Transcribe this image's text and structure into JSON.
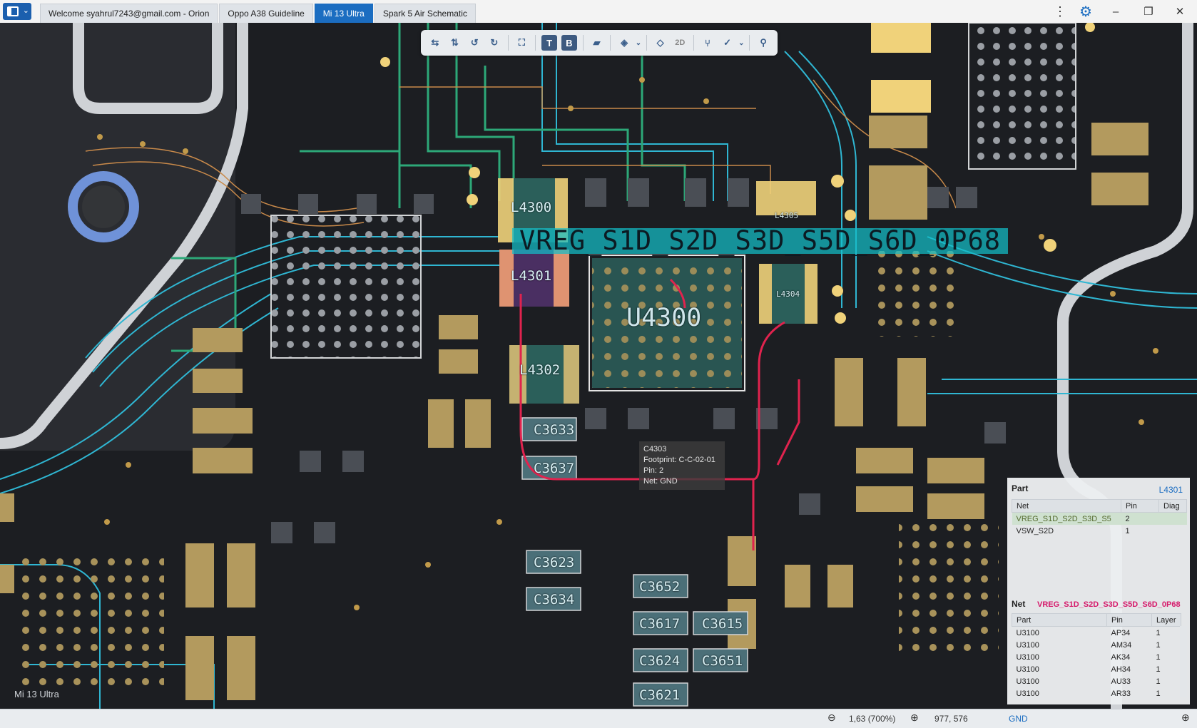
{
  "tabs": [
    {
      "label": "Welcome syahrul7243@gmail.com - Orion",
      "active": false
    },
    {
      "label": "Oppo A38 Guideline",
      "active": false
    },
    {
      "label": "Mi 13 Ultra",
      "active": true
    },
    {
      "label": "Spark 5 Air Schematic",
      "active": false
    }
  ],
  "toolbar": {
    "top_label": "T",
    "bottom_label": "B",
    "view_2d_label": "2D"
  },
  "board": {
    "name": "Mi 13 Ultra",
    "highlighted_net": "VREG_S1D_S2D_S3D_S5D_S6D_0P68",
    "part_labels": [
      "L4300",
      "L4301",
      "L4302",
      "L4305",
      "L4304",
      "U4300",
      "C3633",
      "C3637",
      "C3623",
      "C3634",
      "C3652",
      "C3617",
      "C3615",
      "C3624",
      "C3651",
      "C3621"
    ]
  },
  "tooltip": {
    "part": "C4303",
    "footprint": "Footprint: C-C-02-01",
    "pin": "Pin: 2",
    "net": "Net: GND"
  },
  "part_panel": {
    "title": "Part",
    "part_ref": "L4301",
    "columns": [
      "Net",
      "Pin",
      "Diag"
    ],
    "rows": [
      {
        "net": "VREG_S1D_S2D_S3D_S5",
        "pin": "2",
        "diag": ""
      },
      {
        "net": "VSW_S2D",
        "pin": "1",
        "diag": ""
      }
    ]
  },
  "net_panel": {
    "title": "Net",
    "net_name": "VREG_S1D_S2D_S3D_S5D_S6D_0P68",
    "columns": [
      "Part",
      "Pin",
      "Layer"
    ],
    "rows": [
      {
        "part": "U3100",
        "pin": "AP34",
        "layer": "1"
      },
      {
        "part": "U3100",
        "pin": "AM34",
        "layer": "1"
      },
      {
        "part": "U3100",
        "pin": "AK34",
        "layer": "1"
      },
      {
        "part": "U3100",
        "pin": "AH34",
        "layer": "1"
      },
      {
        "part": "U3100",
        "pin": "AU33",
        "layer": "1"
      },
      {
        "part": "U3100",
        "pin": "AR33",
        "layer": "1"
      }
    ]
  },
  "status": {
    "zoom": "1,63 (700%)",
    "coords": "977, 576",
    "net": "GND"
  },
  "colors": {
    "accent": "#1b6dc1",
    "net_highlight": "#14bec8",
    "trace_red": "#e0234e",
    "pad_gold": "#b39a5e"
  }
}
